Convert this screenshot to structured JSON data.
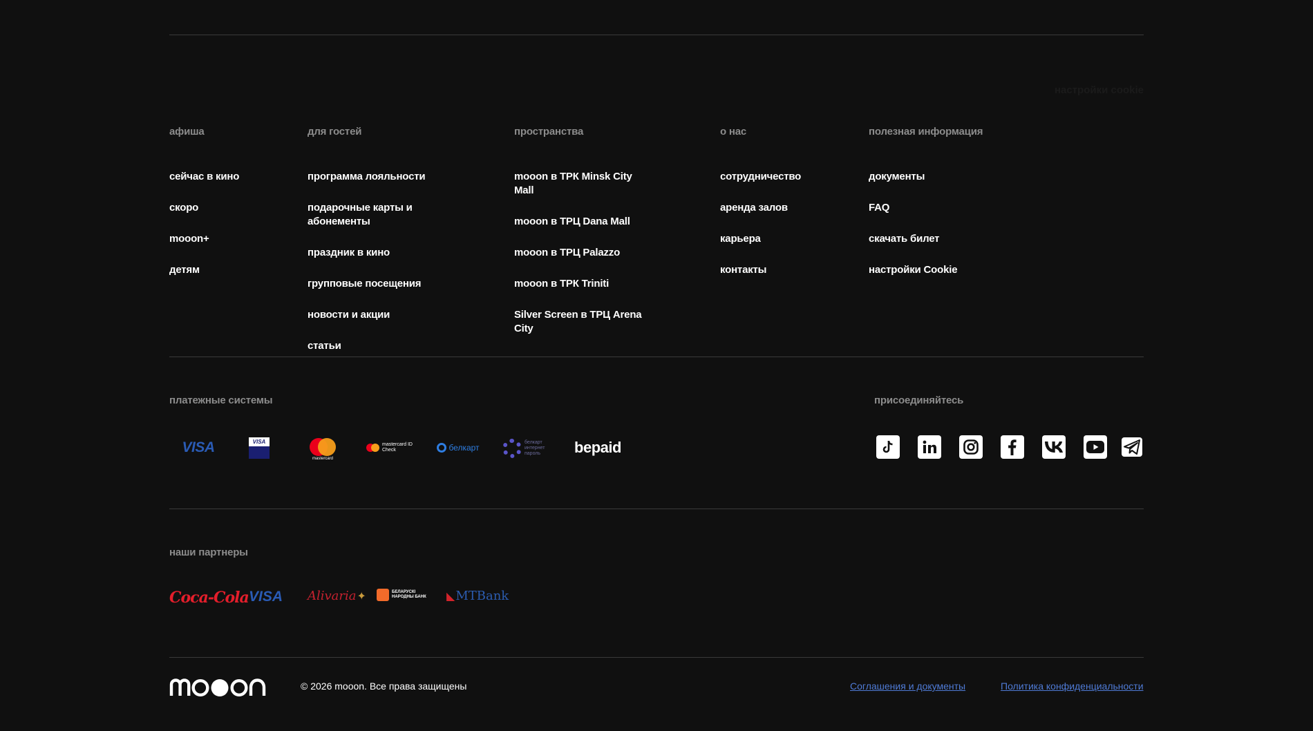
{
  "columns": [
    {
      "heading": "афиша",
      "links": [
        "сейчас в кино",
        "скоро",
        "mooon+",
        "детям"
      ]
    },
    {
      "heading": "для гостей",
      "links": [
        "программа лояльности",
        "подарочные карты и абонементы",
        "праздник в кино",
        "групповые посещения",
        "новости и акции",
        "статьи"
      ]
    },
    {
      "heading": "пространства",
      "links": [
        "mooon в ТРК Minsk City Mall",
        "mooon в ТРЦ Dana Mall",
        "mooon в ТРЦ Palazzo",
        "mooon в ТРК Triniti",
        "Silver Screen в ТРЦ Arena City"
      ]
    },
    {
      "heading": "о нас",
      "links": [
        "сотрудничество",
        "аренда залов",
        "карьера",
        "контакты"
      ]
    },
    {
      "heading": "полезная информация",
      "links": [
        "документы",
        "FAQ",
        "скачать билет",
        "настройки Cookie"
      ]
    }
  ],
  "ghost_text": "настройки cookie",
  "payments": {
    "heading": "платежные системы",
    "items": [
      "VISA",
      "VISA",
      "mastercard",
      "mastercard ID Check",
      "белкарт",
      "белкарт интернет пароль",
      "bepaid"
    ]
  },
  "social": {
    "heading": "присоединяйтесь",
    "icons": [
      "tiktok-icon",
      "linkedin-icon",
      "instagram-icon",
      "facebook-icon",
      "vk-icon",
      "youtube-icon",
      "telegram-icon"
    ]
  },
  "partners": {
    "heading": "наши партнеры",
    "items": [
      "Coca-Cola",
      "VISA",
      "Alivaria",
      "БЕЛАРУСКІ НАРОДНЫ БАНК",
      "MTBank"
    ]
  },
  "footer": {
    "logo": "mooon",
    "copyright": "© 2026 mooon. Все права защищены",
    "agreements": "Соглашения и документы",
    "privacy": "Политика конфиденциальности"
  },
  "colors": {
    "background": "#101010",
    "muted": "#8c8c8c",
    "link_blue": "#4f7bd6"
  }
}
